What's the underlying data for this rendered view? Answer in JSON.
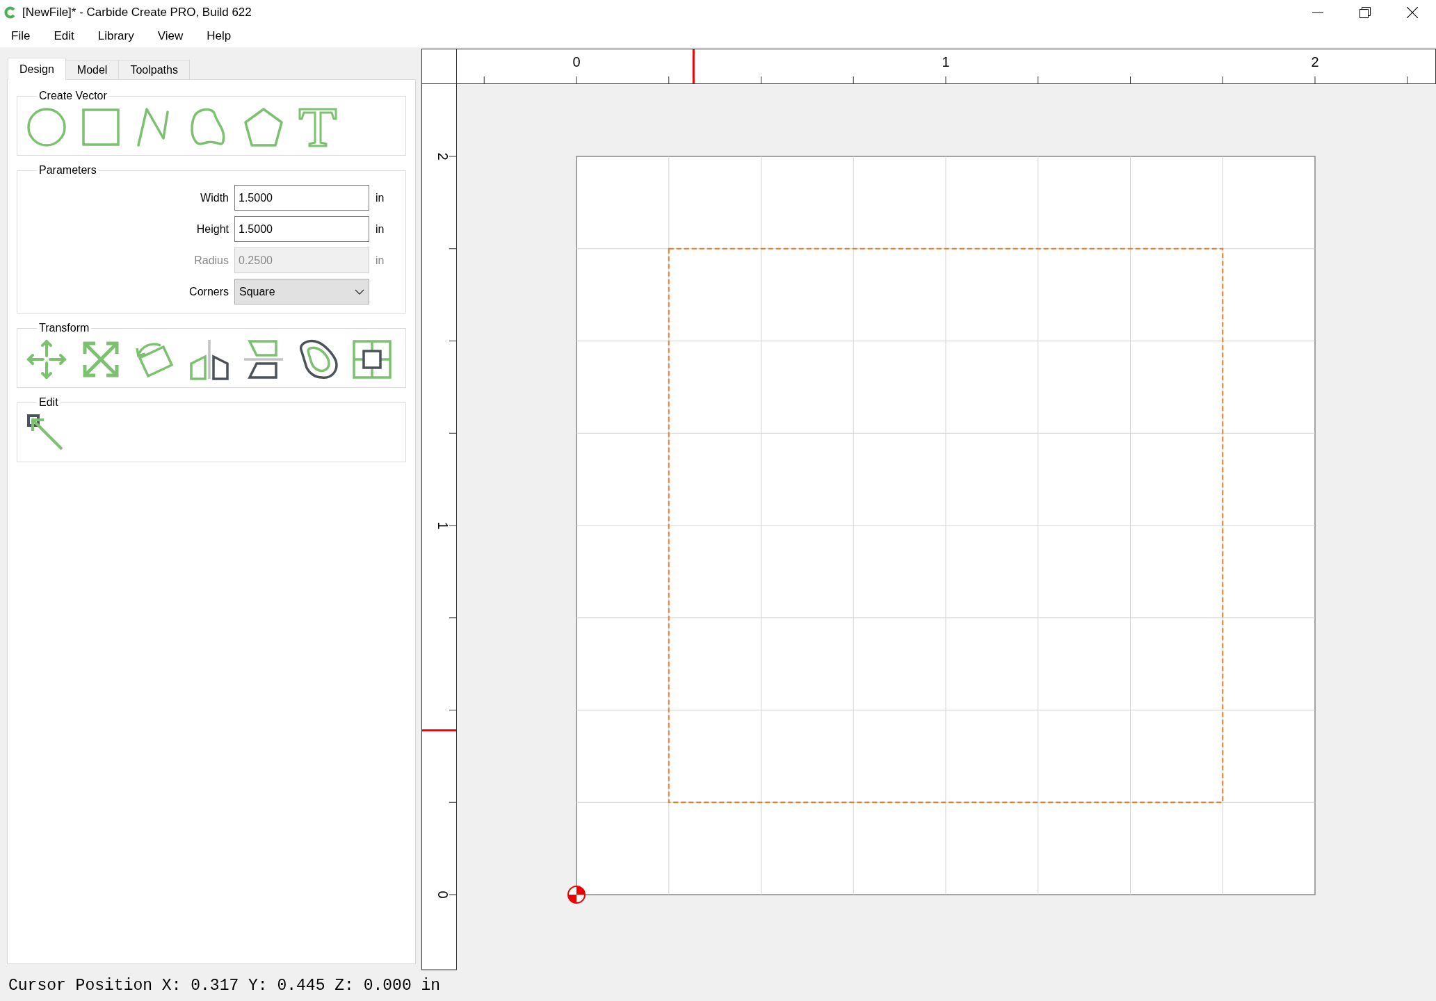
{
  "window": {
    "title": "[NewFile]* - Carbide Create PRO, Build 622"
  },
  "menu": [
    "File",
    "Edit",
    "Library",
    "View",
    "Help"
  ],
  "tabs": [
    {
      "label": "Design",
      "selected": true
    },
    {
      "label": "Model",
      "selected": false
    },
    {
      "label": "Toolpaths",
      "selected": false
    }
  ],
  "create_vector": {
    "title": "Create Vector",
    "tools": [
      {
        "kind": "circle"
      },
      {
        "kind": "rectangle"
      },
      {
        "kind": "polyline"
      },
      {
        "kind": "curve"
      },
      {
        "kind": "polygon"
      },
      {
        "kind": "text"
      }
    ]
  },
  "parameters": {
    "title": "Parameters",
    "fields": [
      {
        "kind": "number",
        "label": "Width",
        "value": "1.5000",
        "unit": "in",
        "disabled": false
      },
      {
        "kind": "number",
        "label": "Height",
        "value": "1.5000",
        "unit": "in",
        "disabled": false
      },
      {
        "kind": "number",
        "label": "Radius",
        "value": "0.2500",
        "unit": "in",
        "disabled": true
      },
      {
        "kind": "dropdown",
        "label": "Corners",
        "value": "Square"
      }
    ]
  },
  "transform": {
    "title": "Transform",
    "tools": [
      {
        "kind": "move"
      },
      {
        "kind": "scale"
      },
      {
        "kind": "rotate"
      },
      {
        "kind": "mirror"
      },
      {
        "kind": "flip"
      },
      {
        "kind": "offset"
      },
      {
        "kind": "align"
      }
    ]
  },
  "edit": {
    "title": "Edit",
    "tools": [
      {
        "kind": "node_edit"
      }
    ]
  },
  "canvas": {
    "top_ruler": [
      "0",
      "1",
      "2"
    ],
    "left_ruler": [
      "2",
      "1",
      "0"
    ],
    "shape": {
      "selected": true
    }
  },
  "status_bar": "Cursor Position X: 0.317 Y: 0.445 Z: 0.000 in"
}
